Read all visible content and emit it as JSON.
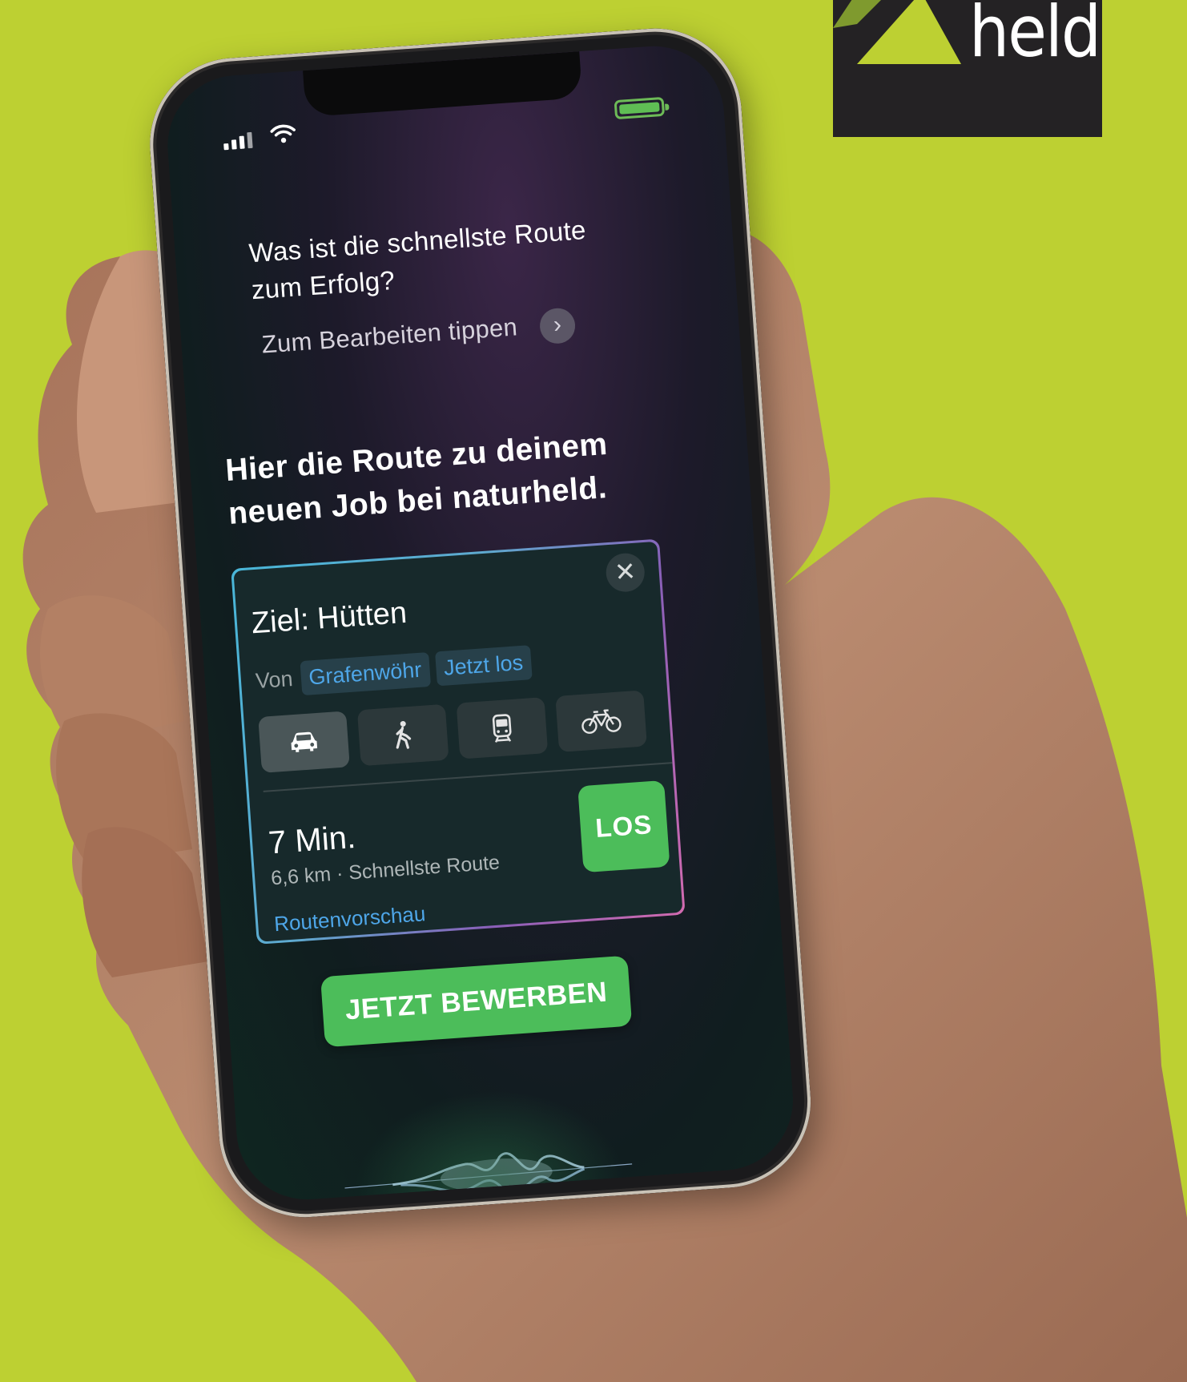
{
  "brand": {
    "logo_text": "held",
    "accent_color": "#bdd032",
    "button_color": "#4cbd5a"
  },
  "status_bar": {
    "signal_icon": "signal-icon",
    "wifi_icon": "wifi-icon",
    "battery_icon": "battery-icon"
  },
  "siri": {
    "question": "Was ist die schnellste Route zum Erfolg?",
    "edit_hint": "Zum Bearbeiten tippen",
    "edit_icon": "chevron-right-icon",
    "headline": "Hier die Route zu deinem neuen Job bei naturheld."
  },
  "route_card": {
    "title": "Ziel: Hütten",
    "from_label": "Von",
    "origin": "Grafenwöhr",
    "departure": "Jetzt los",
    "close_icon": "close-icon",
    "modes": [
      {
        "icon": "car-icon",
        "active": true
      },
      {
        "icon": "walk-icon",
        "active": false
      },
      {
        "icon": "train-icon",
        "active": false
      },
      {
        "icon": "bicycle-icon",
        "active": false
      }
    ],
    "eta": "7 Min.",
    "details": "6,6 km · Schnellste Route",
    "preview_link": "Routenvorschau",
    "go_label": "LOS"
  },
  "cta": {
    "label": "JETZT BEWERBEN"
  }
}
